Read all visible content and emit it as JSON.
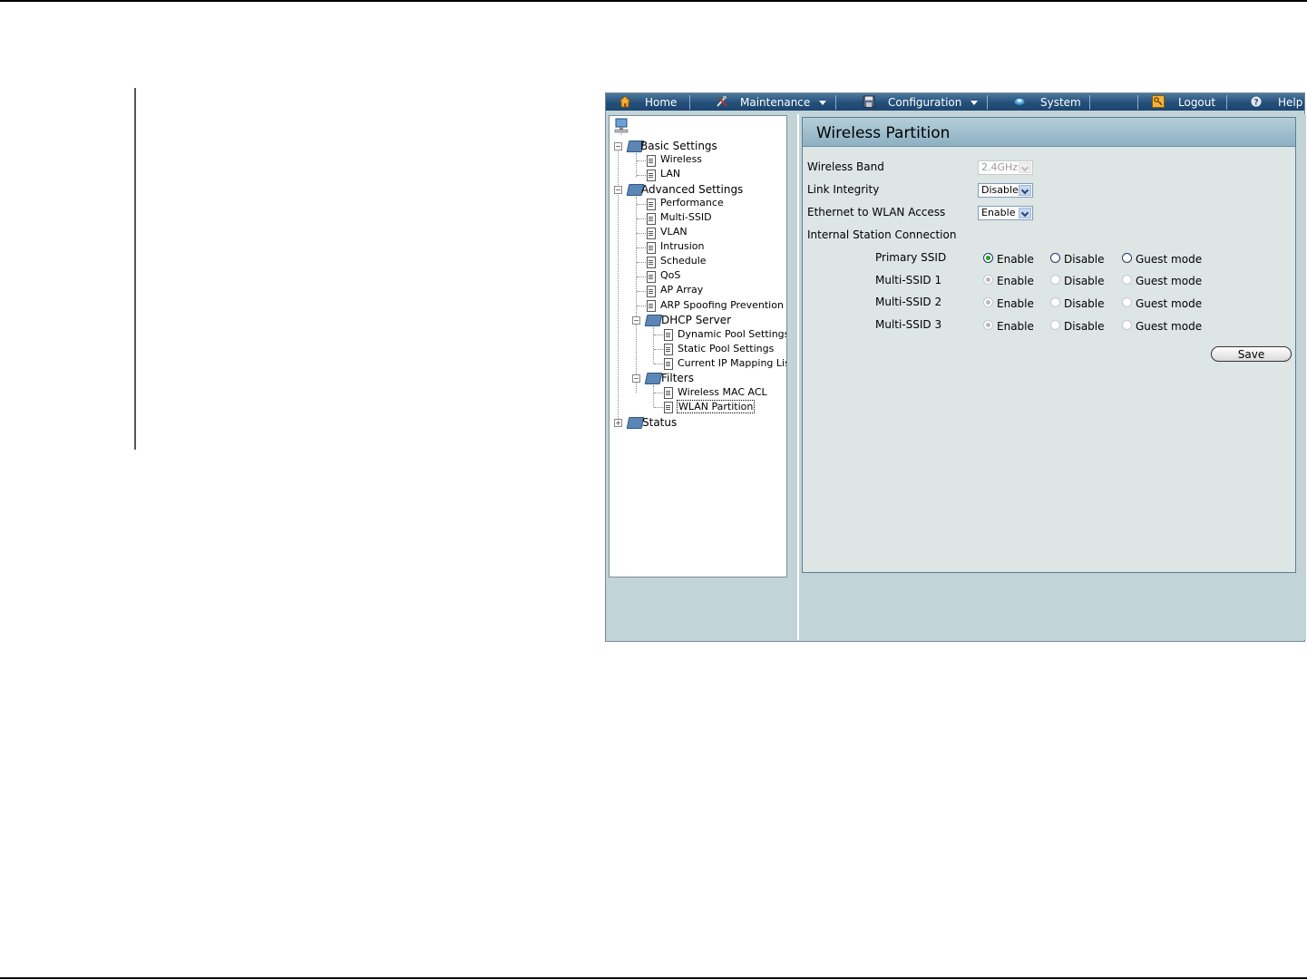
{
  "menu": {
    "home": "Home",
    "maintenance": "Maintenance",
    "configuration": "Configuration",
    "system": "System",
    "logout": "Logout",
    "help": "Help"
  },
  "tree": {
    "basic_settings": "Basic Settings",
    "wireless": "Wireless",
    "lan": "LAN",
    "advanced_settings": "Advanced Settings",
    "performance": "Performance",
    "multi_ssid": "Multi-SSID",
    "vlan": "VLAN",
    "intrusion": "Intrusion",
    "schedule": "Schedule",
    "qos": "QoS",
    "ap_array": "AP Array",
    "arp_spoofing": "ARP Spoofing Prevention",
    "dhcp_server": "DHCP Server",
    "dynamic_pool": "Dynamic Pool Settings",
    "static_pool": "Static Pool Settings",
    "ip_mapping": "Current IP Mapping List",
    "filters": "Filters",
    "wireless_mac_acl": "Wireless MAC ACL",
    "wlan_partition": "WLAN Partition",
    "status": "Status"
  },
  "panel": {
    "title": "Wireless Partition",
    "wireless_band_label": "Wireless Band",
    "wireless_band_value": "2.4GHz",
    "link_integrity_label": "Link Integrity",
    "link_integrity_value": "Disable",
    "eth_wlan_label": "Ethernet to WLAN Access",
    "eth_wlan_value": "Enable",
    "isc_label": "Internal Station Connection",
    "rows": [
      {
        "label": "Primary SSID",
        "selected": "Enable",
        "enabled": true
      },
      {
        "label": "Multi-SSID 1",
        "selected": "Enable",
        "enabled": false
      },
      {
        "label": "Multi-SSID 2",
        "selected": "Enable",
        "enabled": false
      },
      {
        "label": "Multi-SSID 3",
        "selected": "Enable",
        "enabled": false
      }
    ],
    "opt_enable": "Enable",
    "opt_disable": "Disable",
    "opt_guest": "Guest mode",
    "save_label": "Save"
  }
}
